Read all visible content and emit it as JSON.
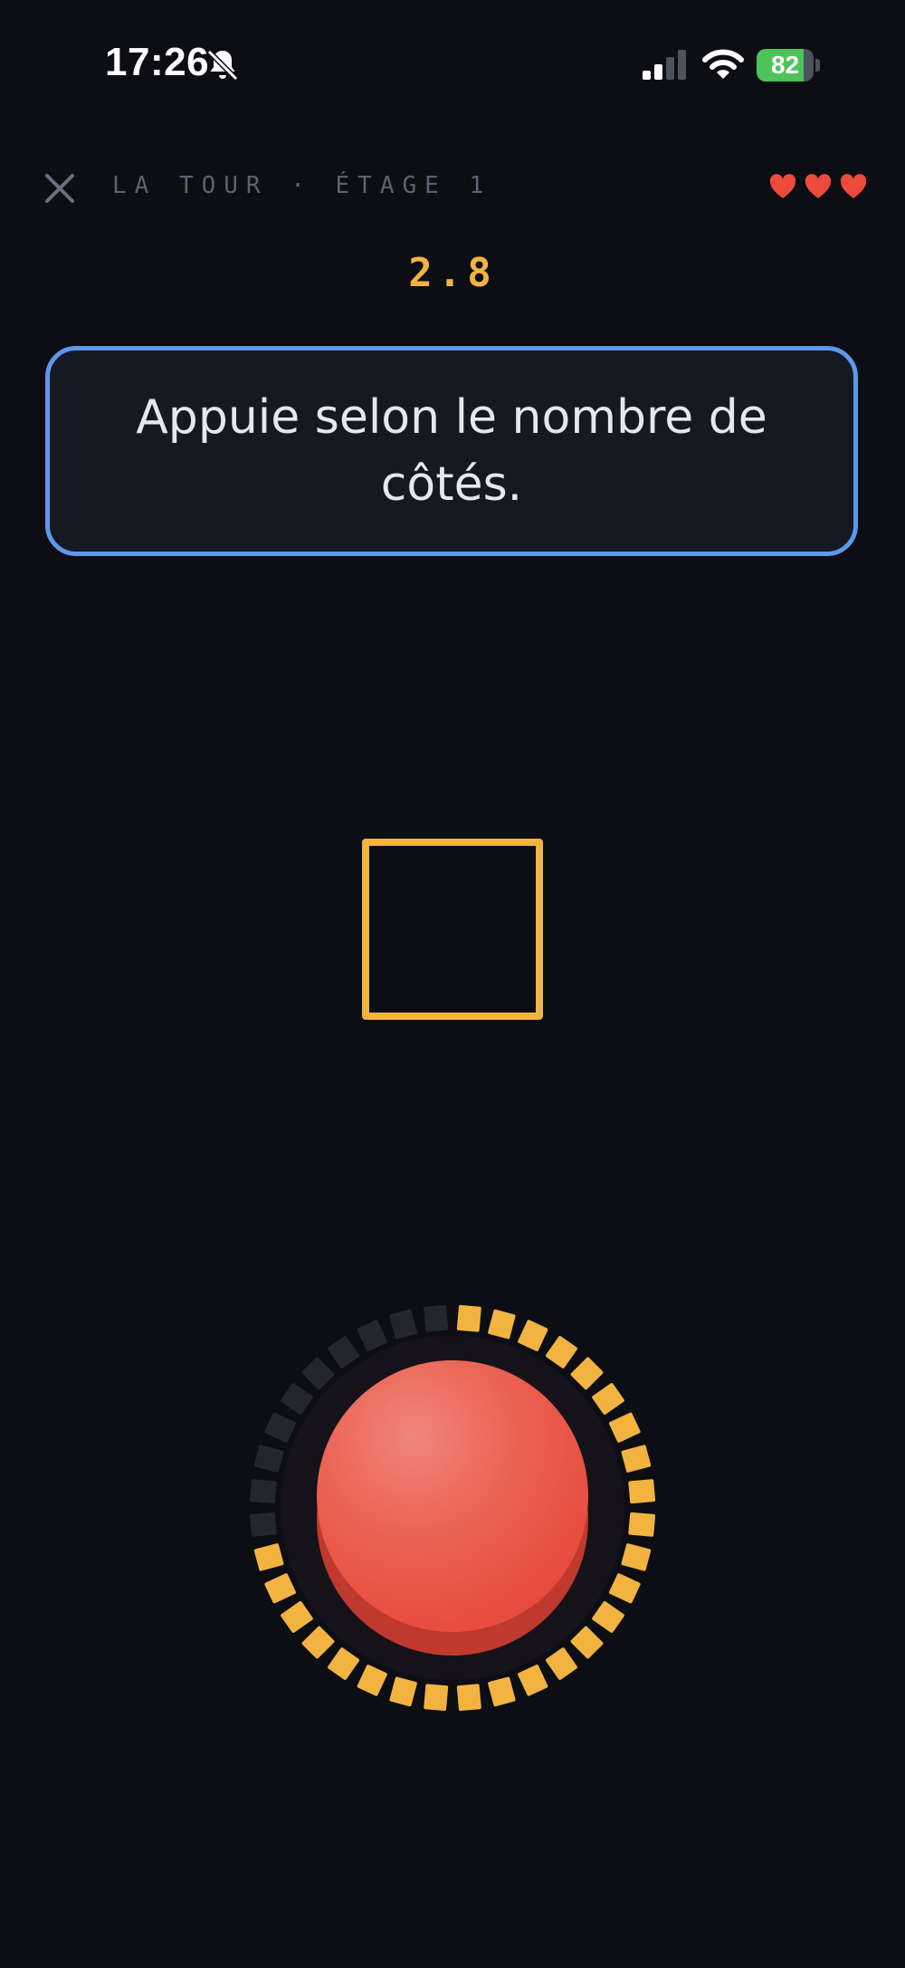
{
  "status_bar": {
    "time": "17:26",
    "battery_percent": "82",
    "battery_level": 0.82,
    "icons": [
      "bell-off-icon",
      "cellular-signal-icon",
      "wifi-icon",
      "battery-icon"
    ]
  },
  "header": {
    "close_icon": "close-icon",
    "level_label": "LA TOUR · ÉTAGE 1",
    "lives": 3,
    "heart_icon": "heart-icon",
    "heart_color": "#ec4b3c"
  },
  "timer": "2.8",
  "instruction": "Appuie selon le nombre de côtés.",
  "shape": {
    "type": "square",
    "color": "#f2b340"
  },
  "press_button": {
    "color": "#e8503f",
    "progress": 0.72,
    "ring_active_color": "#f2b340",
    "ring_inactive_color": "#23262f"
  },
  "colors": {
    "background": "#0c0e14",
    "accent": "#f2b340",
    "card_border": "#5f97ec"
  }
}
